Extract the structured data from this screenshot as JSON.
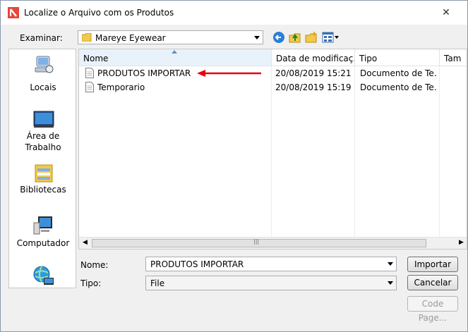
{
  "window": {
    "title": "Localize o Arquivo com os Produtos",
    "close_glyph": "✕"
  },
  "lookin": {
    "label": "Examinar:",
    "value": "Mareye Eyewear"
  },
  "places": [
    {
      "label": "Locais",
      "icon": "recent-places-icon"
    },
    {
      "label": "Área de Trabalho",
      "icon": "desktop-icon"
    },
    {
      "label": "Bibliotecas",
      "icon": "libraries-icon"
    },
    {
      "label": "Computador",
      "icon": "computer-icon"
    },
    {
      "label": "",
      "icon": "network-icon"
    }
  ],
  "columns": {
    "name": "Nome",
    "date": "Data de modificaç...",
    "type": "Tipo",
    "size": "Tam"
  },
  "files": [
    {
      "name": "PRODUTOS IMPORTAR",
      "date": "20/08/2019 15:21",
      "type": "Documento de Te..."
    },
    {
      "name": "Temporario",
      "date": "20/08/2019 15:19",
      "type": "Documento de Te..."
    }
  ],
  "filename": {
    "label": "Nome:",
    "value": "PRODUTOS IMPORTAR"
  },
  "filetype": {
    "label": "Tipo:",
    "value": "File"
  },
  "buttons": {
    "import": "Importar",
    "cancel": "Cancelar",
    "codepage": "Code Page..."
  },
  "colors": {
    "annotation_arrow": "#e8000d",
    "accent": "#e8453c"
  }
}
